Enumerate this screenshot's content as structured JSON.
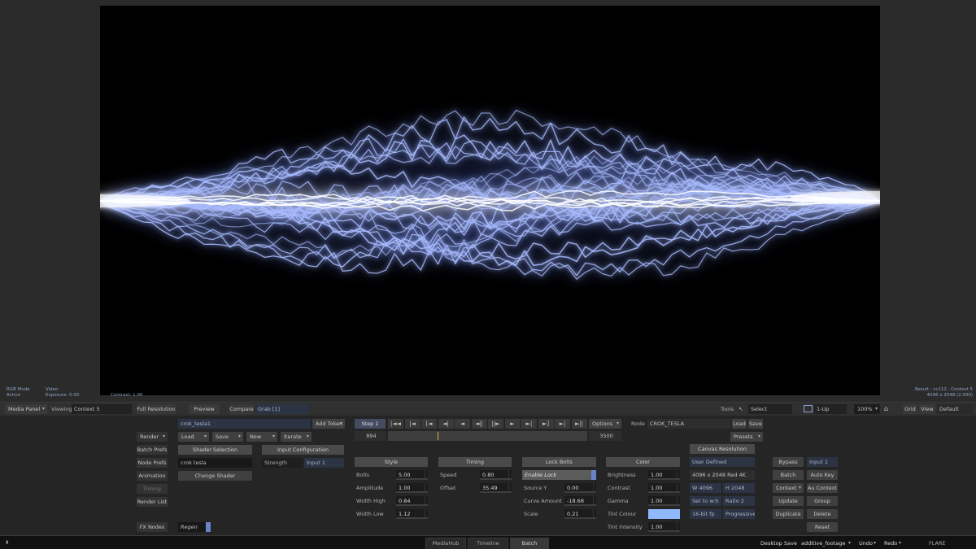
{
  "viewport": {
    "status_left": {
      "mode": "RGB Mode",
      "state": "Active",
      "source": "Video",
      "exposure": "Exposure: 0.00",
      "contrast": "Contrast: 1.00"
    },
    "status_right": {
      "result": "Result : cc112 : Context 5",
      "resolution": "4096 x 2048 (2.000)"
    }
  },
  "viewer_bar": {
    "media_panel": "Media Panel",
    "viewing_label": "Viewing",
    "viewing_value": "Context 5",
    "full_resolution": "Full Resolution",
    "preview": "Preview",
    "compare": "Compare",
    "grab": "Grab [1]",
    "tools_label": "Tools",
    "select": "Select",
    "layout": "1-Up",
    "zoom": "100%",
    "grid": "Grid",
    "view": "View",
    "default": "Default"
  },
  "left_column": {
    "render": "Render",
    "batch_prefs": "Batch Prefs",
    "node_prefs": "Node Prefs",
    "animation": "Animation",
    "timing": "Timing",
    "render_list": "Render List",
    "fx_nodes": "FX Nodes"
  },
  "setup": {
    "setup_name": "crok_tesla1",
    "add_token": "Add Token",
    "load": "Load",
    "save": "Save",
    "new": "New",
    "iterate": "Iterate",
    "shader_selection": "Shader Selection",
    "shader_name": "crok tesla",
    "change_shader": "Change Shader",
    "input_configuration": "Input Configuration",
    "strength_label": "Strength",
    "strength_input": "Input 1",
    "regen": "Regen"
  },
  "transport": {
    "step": "Step 1",
    "buttons": [
      "|◄◄",
      "|◄",
      "[◄",
      "◄|",
      "◄",
      "◄||",
      "||►",
      "►",
      "►|",
      "►]",
      "►|",
      "►||"
    ],
    "options": "Options",
    "start_frame": "894",
    "end_frame": "3500",
    "playhead": 0.25
  },
  "node": {
    "label": "Node",
    "name": "CROK_TESLA",
    "load": "Load",
    "save": "Save",
    "presets": "Presets"
  },
  "style": {
    "header": "Style",
    "bolts_label": "Bolts",
    "bolts": "5.00",
    "amplitude_label": "Amplitude",
    "amplitude": "1.00",
    "width_high_label": "Width High",
    "width_high": "0.84",
    "width_low_label": "Width Low",
    "width_low": "1.12"
  },
  "timing": {
    "header": "Timing",
    "speed_label": "Speed",
    "speed": "0.80",
    "offset_label": "Offset",
    "offset": "35.49"
  },
  "lock_bolts": {
    "header": "Lock Bolts",
    "enable_lock": "Enable Lock",
    "source_y_label": "Source Y",
    "source_y": "0.00",
    "curve_amount_label": "Curve Amount",
    "curve_amount": "-18.68",
    "scale_label": "Scale",
    "scale": "0.21"
  },
  "color": {
    "header": "Color",
    "brightness_label": "Brightness",
    "brightness": "1.00",
    "contrast_label": "Contrast",
    "contrast": "1.00",
    "gamma_label": "Gamma",
    "gamma": "1.00",
    "tint_colour_label": "Tint Colour",
    "tint_colour": "#8fb8ff",
    "tint_intensity_label": "Tint Intensity",
    "tint_intensity": "1.00"
  },
  "canvas": {
    "header": "Canvas Resolution",
    "mode": "User Defined",
    "preset": "4096 x 2048 Red 4K",
    "width": "W 4096",
    "height": "H 2048",
    "set_to_wh": "Set to w:h",
    "ratio": "Ratio 2",
    "bit_depth": "16-bit fp",
    "scan": "Progressive"
  },
  "right_column": {
    "bypass": "Bypass",
    "input": "Input 1",
    "batch": "Batch",
    "auto_key": "Auto Key",
    "context": "Context",
    "au_context": "Au Context",
    "update": "Update",
    "group": "Group",
    "duplicate": "Duplicate",
    "delete": "Delete",
    "reset": "Reset"
  },
  "footer": {
    "tabs": [
      "MediaHub",
      "Timeline",
      "Batch"
    ],
    "desktop": "Desktop",
    "save": "Save",
    "project": "additive_footage",
    "undo": "Undo",
    "redo": "Redo",
    "app": "FLARE"
  },
  "colors": {
    "accent": "#6a82c8",
    "bolt_core": "#ffffff",
    "bolt_glow": "#6f8cff"
  }
}
